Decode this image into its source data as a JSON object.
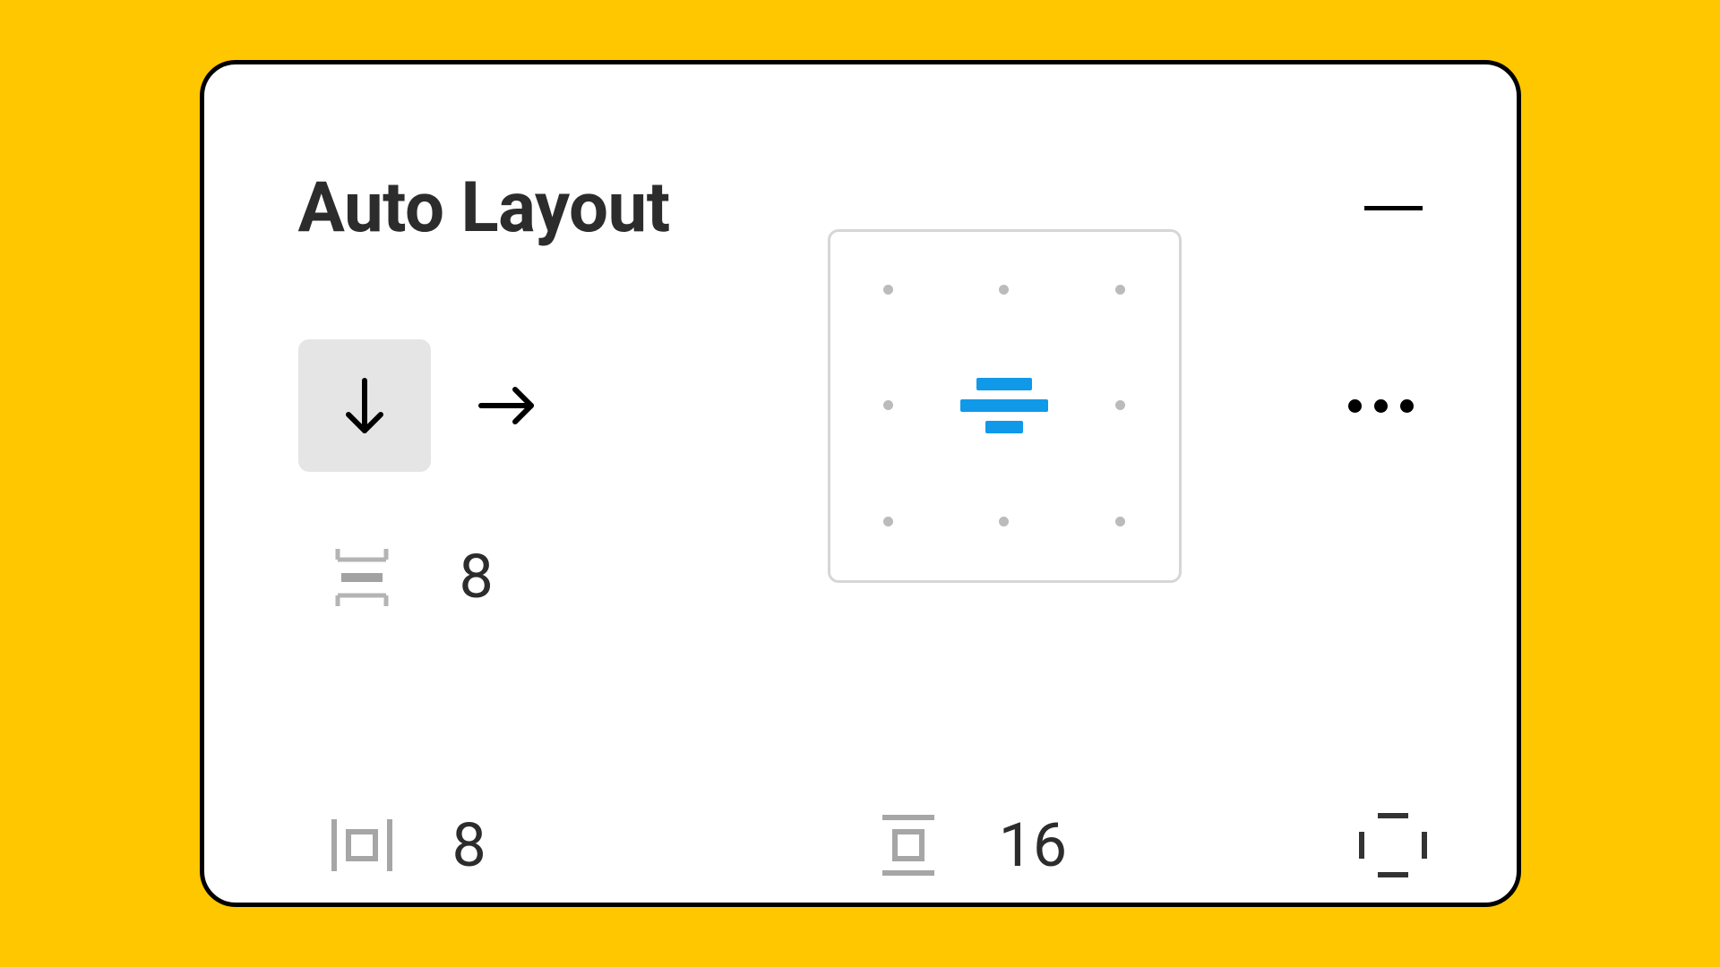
{
  "panel": {
    "title": "Auto Layout",
    "direction": {
      "vertical_selected": true
    },
    "spacing": {
      "item_spacing": "8"
    },
    "padding": {
      "horizontal": "8",
      "vertical": "16"
    },
    "alignment": {
      "selected": "center"
    },
    "colors": {
      "accent": "#1099E8"
    }
  }
}
